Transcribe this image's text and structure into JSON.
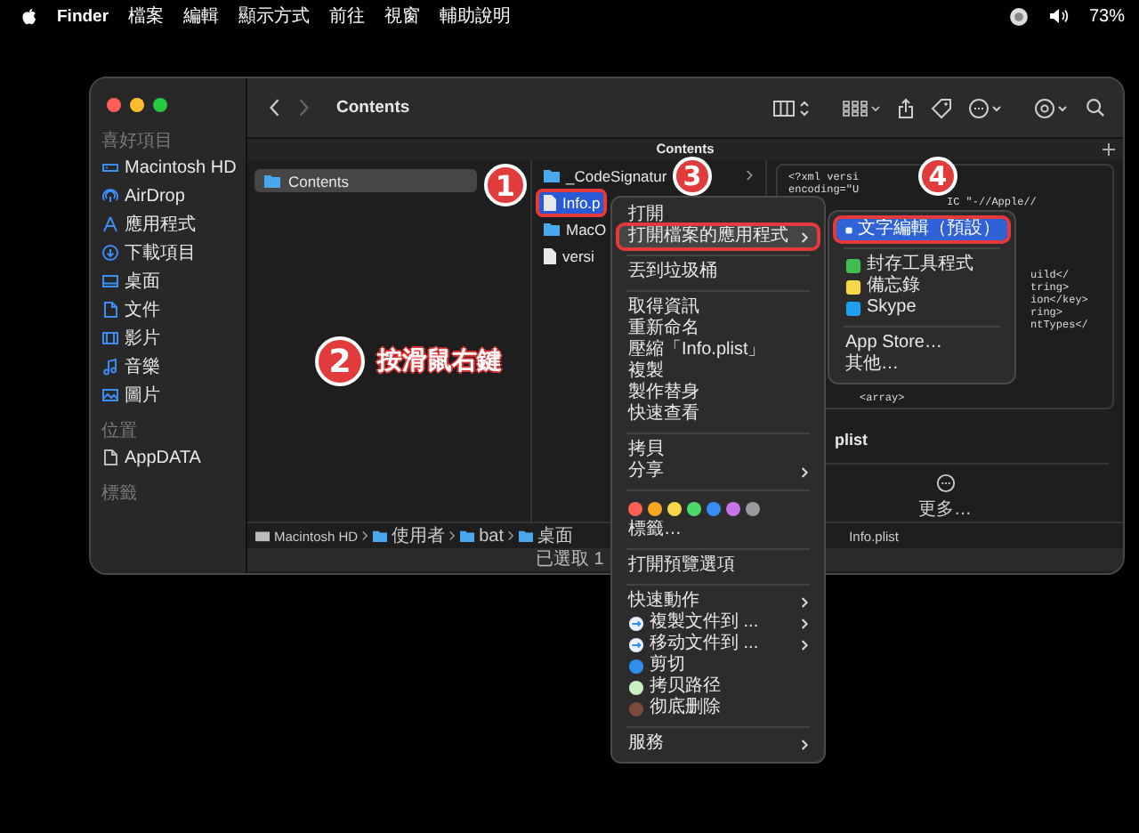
{
  "menubar": {
    "app": "Finder",
    "menus": [
      "檔案",
      "編輯",
      "顯示方式",
      "前往",
      "視窗",
      "輔助說明"
    ],
    "battery": "73%"
  },
  "window": {
    "title": "Contents",
    "tab": "Contents",
    "sidebar": {
      "sections": [
        {
          "header": "喜好項目",
          "items": [
            {
              "label": "Macintosh HD",
              "kind": "disk"
            },
            {
              "label": "AirDrop",
              "kind": "airdrop"
            },
            {
              "label": "應用程式",
              "kind": "apps"
            },
            {
              "label": "下載項目",
              "kind": "download"
            },
            {
              "label": "桌面",
              "kind": "desktop"
            },
            {
              "label": "文件",
              "kind": "document"
            },
            {
              "label": "影片",
              "kind": "movie"
            },
            {
              "label": "音樂",
              "kind": "music"
            },
            {
              "label": "圖片",
              "kind": "picture"
            }
          ]
        },
        {
          "header": "位置",
          "items": [
            {
              "label": "AppDATA",
              "kind": "file"
            }
          ]
        },
        {
          "header": "標籤"
        }
      ]
    },
    "column_1": [
      {
        "label": "Contents",
        "selected": true
      }
    ],
    "column_2": [
      {
        "label": "_CodeSignatur",
        "kind": "folder",
        "selected": false,
        "outlined": false,
        "has_children": true
      },
      {
        "label": "Info.p",
        "kind": "file",
        "selected": true,
        "outlined": true
      },
      {
        "label": "MacO",
        "kind": "folder",
        "selected": false,
        "outlined": false
      },
      {
        "label": "versi",
        "kind": "file",
        "selected": false,
        "outlined": false
      }
    ],
    "preview": {
      "code_lines": [
        {
          "text": "<?xml versi",
          "kind": "start"
        },
        {
          "text": "encoding=\"U",
          "kind": "start"
        },
        {
          "text": "IC \"-//Apple//",
          "kind": "middle"
        },
        {
          "text": "uild</",
          "kind": "end"
        },
        {
          "text": "tring>",
          "kind": "end"
        },
        {
          "text": "ion</key>",
          "kind": "end"
        },
        {
          "text": "ring>",
          "kind": "end"
        },
        {
          "text": "ntTypes</",
          "kind": "end"
        },
        {
          "text": "<array>",
          "kind": "nested"
        }
      ],
      "filename": "plist",
      "more": "更多…"
    },
    "path_bar": {
      "crumbs": [
        {
          "label": "Macintosh HD",
          "kind": "disk"
        },
        {
          "label": "使用者",
          "kind": "folder"
        },
        {
          "label": "bat",
          "kind": "folder"
        },
        {
          "label": "桌面",
          "kind": "folder"
        }
      ],
      "last": "Info.plist"
    },
    "status": "已選取 1"
  },
  "context_menu": {
    "items": [
      {
        "kind": "item",
        "label": "打開",
        "selected": false,
        "submenu": false,
        "outlined": false
      },
      {
        "kind": "item",
        "label": "打開檔案的應用程式",
        "selected": true,
        "submenu": true,
        "outlined": true
      },
      {
        "kind": "separator"
      },
      {
        "kind": "item",
        "label": "丟到垃圾桶",
        "selected": false,
        "submenu": false,
        "outlined": false
      },
      {
        "kind": "separator"
      },
      {
        "kind": "item",
        "label": "取得資訊",
        "selected": false,
        "submenu": false,
        "outlined": false
      },
      {
        "kind": "item",
        "label": "重新命名",
        "selected": false,
        "submenu": false,
        "outlined": false
      },
      {
        "kind": "item",
        "label": "壓縮「Info.plist」",
        "selected": false,
        "submenu": false,
        "outlined": false
      },
      {
        "kind": "item",
        "label": "複製",
        "selected": false,
        "submenu": false,
        "outlined": false
      },
      {
        "kind": "item",
        "label": "製作替身",
        "selected": false,
        "submenu": false,
        "outlined": false
      },
      {
        "kind": "item",
        "label": "快速查看",
        "selected": false,
        "submenu": false,
        "outlined": false
      },
      {
        "kind": "separator"
      },
      {
        "kind": "item",
        "label": "拷貝",
        "selected": false,
        "submenu": false,
        "outlined": false
      },
      {
        "kind": "item",
        "label": "分享",
        "selected": false,
        "submenu": true,
        "outlined": false
      },
      {
        "kind": "separator"
      },
      {
        "kind": "tags",
        "colors": [
          {
            "color": "#ff5f57"
          },
          {
            "color": "#f5a623"
          },
          {
            "color": "#f7d84a"
          },
          {
            "color": "#4cd964"
          },
          {
            "color": "#3b8cf5"
          },
          {
            "color": "#c774e8"
          },
          {
            "color": "#9a9a9e"
          }
        ]
      },
      {
        "kind": "item",
        "label": "標籤…",
        "selected": false,
        "submenu": false,
        "outlined": false
      },
      {
        "kind": "separator"
      },
      {
        "kind": "item",
        "label": "打開預覽選項",
        "selected": false,
        "submenu": false,
        "outlined": false
      },
      {
        "kind": "separator"
      },
      {
        "kind": "item",
        "label": "快速動作",
        "selected": false,
        "submenu": true,
        "outlined": false
      },
      {
        "kind": "action",
        "label": "複製文件到 ...",
        "selected": false,
        "submenu": true,
        "outlined": false
      },
      {
        "kind": "action",
        "label": "移动文件到 ...",
        "selected": false,
        "submenu": true,
        "outlined": false
      },
      {
        "kind": "action",
        "label": "剪切",
        "selected": false,
        "submenu": false,
        "outlined": false
      },
      {
        "kind": "action",
        "label": "拷贝路径",
        "selected": false,
        "submenu": false,
        "outlined": false
      },
      {
        "kind": "action",
        "label": "彻底删除",
        "selected": false,
        "submenu": false,
        "outlined": false
      },
      {
        "kind": "separator"
      },
      {
        "kind": "item",
        "label": "服務",
        "selected": false,
        "submenu": true,
        "outlined": false
      }
    ]
  },
  "submenu": {
    "items": [
      {
        "kind": "app",
        "label": "文字編輯（預設）",
        "selected": true,
        "outlined": true
      },
      {
        "kind": "separator"
      },
      {
        "kind": "app",
        "label": "封存工具程式",
        "selected": false,
        "outlined": false
      },
      {
        "kind": "app",
        "label": "備忘錄",
        "selected": false,
        "outlined": false
      },
      {
        "kind": "app",
        "label": "Skype",
        "selected": false,
        "outlined": false
      },
      {
        "kind": "separator"
      },
      {
        "kind": "item",
        "label": "App Store…",
        "selected": false,
        "outlined": false
      },
      {
        "kind": "item",
        "label": "其他…",
        "selected": false,
        "outlined": false
      }
    ]
  },
  "annotations": {
    "badges": [
      "1",
      "2",
      "3",
      "4"
    ],
    "note": "按滑鼠右鍵"
  }
}
